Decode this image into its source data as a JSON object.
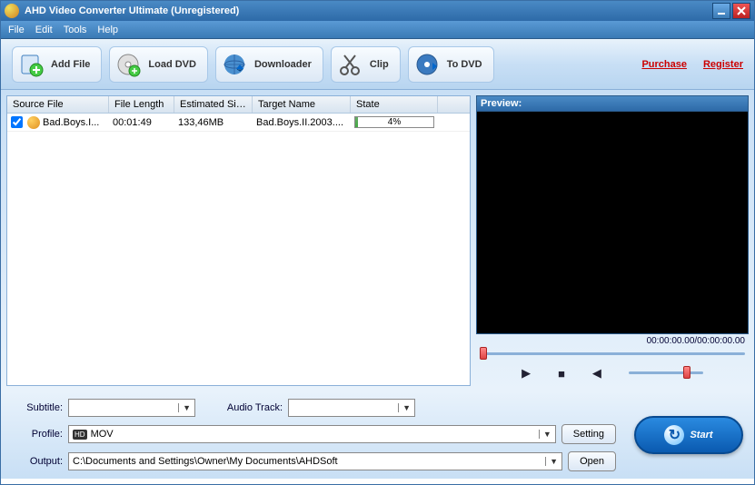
{
  "title": "AHD Video Converter Ultimate (Unregistered)",
  "menu": {
    "file": "File",
    "edit": "Edit",
    "tools": "Tools",
    "help": "Help"
  },
  "toolbar": {
    "add_file": "Add File",
    "load_dvd": "Load DVD",
    "downloader": "Downloader",
    "clip": "Clip",
    "to_dvd": "To DVD",
    "purchase": "Purchase",
    "register": "Register"
  },
  "table": {
    "headers": {
      "source": "Source File",
      "length": "File Length",
      "size": "Estimated Size",
      "target": "Target Name",
      "state": "State"
    },
    "rows": [
      {
        "checked": true,
        "source": "Bad.Boys.I...",
        "length": "00:01:49",
        "size": "133,46MB",
        "target": "Bad.Boys.II.2003....",
        "progress_pct": 4,
        "progress_text": "4%"
      }
    ]
  },
  "preview": {
    "label": "Preview:",
    "time": "00:00:00.00/00:00:00.00"
  },
  "form": {
    "subtitle_label": "Subtitle:",
    "subtitle_value": "",
    "audiotrack_label": "Audio Track:",
    "audiotrack_value": "",
    "profile_label": "Profile:",
    "profile_value": "MOV",
    "profile_badge": "HD",
    "output_label": "Output:",
    "output_value": "C:\\Documents and Settings\\Owner\\My Documents\\AHDSoft",
    "setting_btn": "Setting",
    "open_btn": "Open"
  },
  "start_label": "Start"
}
